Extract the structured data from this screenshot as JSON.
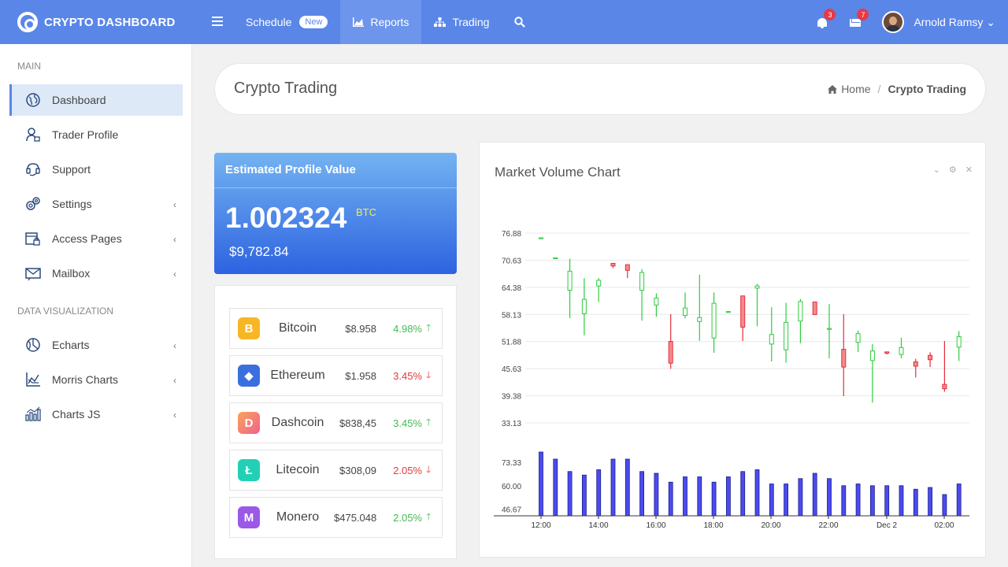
{
  "topbar": {
    "brand": "CRYPTO DASHBOARD",
    "nav": [
      {
        "label": "Schedule",
        "badge": "New",
        "icon": ""
      },
      {
        "label": "Reports",
        "icon": "bar-chart-icon"
      },
      {
        "label": "Trading",
        "icon": "sitemap-icon"
      }
    ],
    "notifications_count": "3",
    "messages_count": "7",
    "username": "Arnold Ramsy"
  },
  "sidebar": {
    "sections": [
      {
        "title": "MAIN",
        "items": [
          {
            "label": "Dashboard",
            "icon": "globe-icon",
            "active": true
          },
          {
            "label": "Trader Profile",
            "icon": "trader-icon"
          },
          {
            "label": "Support",
            "icon": "support-icon"
          },
          {
            "label": "Settings",
            "icon": "settings-icon",
            "chevron": true
          },
          {
            "label": "Access Pages",
            "icon": "lock-icon",
            "chevron": true
          },
          {
            "label": "Mailbox",
            "icon": "mail-icon",
            "chevron": true
          }
        ]
      },
      {
        "title": "DATA VISUALIZATION",
        "items": [
          {
            "label": "Echarts",
            "icon": "echarts-icon",
            "chevron": true
          },
          {
            "label": "Morris Charts",
            "icon": "morris-icon",
            "chevron": true
          },
          {
            "label": "Charts JS",
            "icon": "chartjs-icon",
            "chevron": true
          }
        ]
      }
    ]
  },
  "header": {
    "title": "Crypto Trading",
    "breadcrumb_home": "Home",
    "breadcrumb_current": "Crypto Trading"
  },
  "profile": {
    "title": "Estimated Profile Value",
    "value": "1.002324",
    "unit": "BTC",
    "usd": "$9,782.84"
  },
  "coins": [
    {
      "name": "Bitcoin",
      "price": "$8.958",
      "change": "4.98%",
      "trend": "up",
      "color": "#f7b624",
      "glyph": "B"
    },
    {
      "name": "Ethereum",
      "price": "$1.958",
      "change": "3.45%",
      "trend": "down",
      "color": "#3a6fe0",
      "glyph": "◆"
    },
    {
      "name": "Dashcoin",
      "price": "$838,45",
      "change": "3.45%",
      "trend": "up",
      "color": "#f47a7a",
      "glyph": "D"
    },
    {
      "name": "Litecoin",
      "price": "$308,09",
      "change": "2.05%",
      "trend": "down",
      "color": "#22d1b5",
      "glyph": "Ł"
    },
    {
      "name": "Monero",
      "price": "$475.048",
      "change": "2.05%",
      "trend": "up",
      "color": "#9b59e8",
      "glyph": "M"
    }
  ],
  "chart": {
    "title": "Market Volume Chart"
  },
  "chart_data": {
    "type": "candlestick",
    "title": "Market Volume Chart",
    "price_ticks": [
      "76.88",
      "70.63",
      "64.38",
      "58.13",
      "51.88",
      "45.63",
      "39.38",
      "33.13"
    ],
    "volume_ticks": [
      "73.33",
      "60.00",
      "46.67"
    ],
    "x_labels": [
      "12:00",
      "14:00",
      "16:00",
      "18:00",
      "20:00",
      "22:00",
      "Dec 2",
      "02:00"
    ],
    "up_color": "#2ecc40",
    "down_color": "#e82c3c",
    "volume_color": "#4b4bf0",
    "candles": [
      {
        "o": 75.8,
        "h": 75.8,
        "l": 75.8,
        "c": 75.8,
        "v": 79
      },
      {
        "o": 71.2,
        "h": 71.2,
        "l": 71.2,
        "c": 71.2,
        "v": 75
      },
      {
        "o": 63.7,
        "h": 71.0,
        "l": 57.3,
        "c": 68.1,
        "v": 68
      },
      {
        "o": 58.3,
        "h": 66.5,
        "l": 53.3,
        "c": 61.6,
        "v": 66
      },
      {
        "o": 64.7,
        "h": 66.5,
        "l": 61.0,
        "c": 66.0,
        "v": 69
      },
      {
        "o": 69.9,
        "h": 69.9,
        "l": 68.8,
        "c": 69.3,
        "v": 75
      },
      {
        "o": 69.6,
        "h": 69.6,
        "l": 66.5,
        "c": 68.3,
        "v": 75
      },
      {
        "o": 63.7,
        "h": 68.6,
        "l": 56.7,
        "c": 67.8,
        "v": 68
      },
      {
        "o": 60.3,
        "h": 63.0,
        "l": 57.6,
        "c": 61.9,
        "v": 67
      },
      {
        "o": 51.9,
        "h": 58.2,
        "l": 45.6,
        "c": 46.9,
        "v": 62
      },
      {
        "o": 57.9,
        "h": 63.2,
        "l": 57.2,
        "c": 59.6,
        "v": 65
      },
      {
        "o": 56.5,
        "h": 67.3,
        "l": 52.1,
        "c": 57.4,
        "v": 65
      },
      {
        "o": 52.7,
        "h": 63.2,
        "l": 49.3,
        "c": 60.7,
        "v": 62
      },
      {
        "o": 58.8,
        "h": 58.8,
        "l": 58.8,
        "c": 58.8,
        "v": 65
      },
      {
        "o": 62.4,
        "h": 62.4,
        "l": 52.0,
        "c": 55.2,
        "v": 68
      },
      {
        "o": 64.2,
        "h": 65.2,
        "l": 55.4,
        "c": 64.7,
        "v": 69
      },
      {
        "o": 51.3,
        "h": 59.8,
        "l": 47.3,
        "c": 53.5,
        "v": 61
      },
      {
        "o": 50.0,
        "h": 60.8,
        "l": 47.0,
        "c": 56.3,
        "v": 61
      },
      {
        "o": 56.6,
        "h": 61.7,
        "l": 51.5,
        "c": 61.1,
        "v": 64
      },
      {
        "o": 61.0,
        "h": 61.0,
        "l": 58.0,
        "c": 58.1,
        "v": 67
      },
      {
        "o": 54.9,
        "h": 60.5,
        "l": 48.0,
        "c": 54.9,
        "v": 64
      },
      {
        "o": 50.1,
        "h": 58.2,
        "l": 39.3,
        "c": 46.0,
        "v": 60
      },
      {
        "o": 51.7,
        "h": 54.4,
        "l": 49.5,
        "c": 53.7,
        "v": 61
      },
      {
        "o": 47.5,
        "h": 51.3,
        "l": 37.8,
        "c": 49.7,
        "v": 60
      },
      {
        "o": 49.5,
        "h": 49.5,
        "l": 48.9,
        "c": 49.2,
        "v": 60
      },
      {
        "o": 48.9,
        "h": 52.8,
        "l": 48.0,
        "c": 50.5,
        "v": 60
      },
      {
        "o": 47.2,
        "h": 47.9,
        "l": 43.6,
        "c": 46.2,
        "v": 58
      },
      {
        "o": 48.7,
        "h": 49.4,
        "l": 46.0,
        "c": 47.7,
        "v": 59
      },
      {
        "o": 42.0,
        "h": 52.0,
        "l": 40.3,
        "c": 41.0,
        "v": 55
      },
      {
        "o": 50.6,
        "h": 54.3,
        "l": 47.4,
        "c": 53.0,
        "v": 61
      }
    ]
  }
}
